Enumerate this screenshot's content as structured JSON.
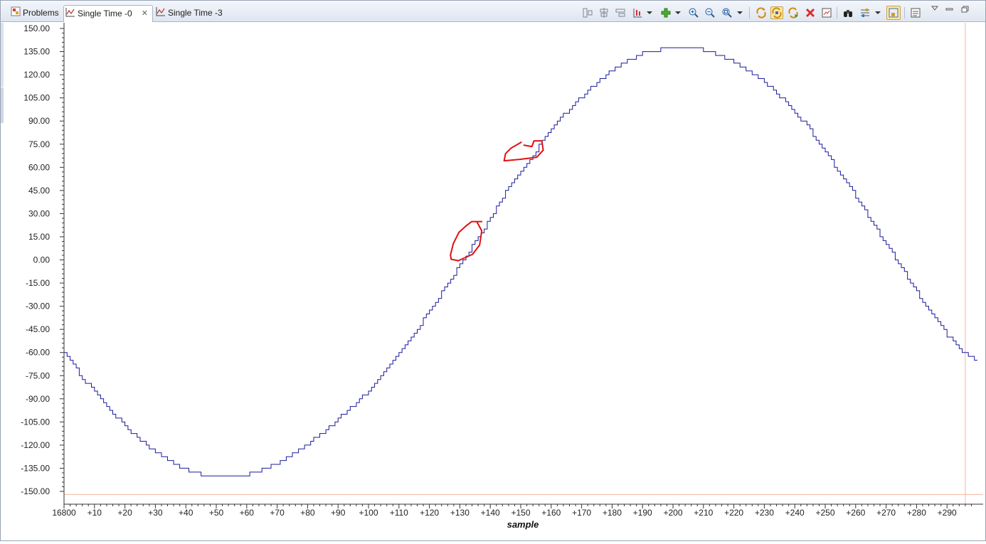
{
  "tabs": [
    {
      "label": "Problems"
    },
    {
      "label": "Single Time -0"
    },
    {
      "label": "Single Time -3"
    }
  ],
  "toolbar_icons": [
    "align-left-icon",
    "align-center-icon",
    "align-right-icon",
    "chart-cursor-icon",
    "add-graph-icon",
    "zoom-in-icon",
    "zoom-out-icon",
    "zoom-fit-icon",
    "refresh-icon",
    "auto-refresh-icon",
    "continuous-refresh-icon",
    "remove-icon",
    "export-icon",
    "find-icon",
    "properties-icon",
    "pin-icon",
    "legend-icon",
    "view-menu-icon",
    "minimize-icon",
    "maximize-icon"
  ],
  "colors": {
    "series": "#1a1a9c",
    "annotation": "#e01010",
    "limit_line": "#f2b6a0",
    "axis": "#333333"
  },
  "chart_data": {
    "type": "line",
    "xlabel": "sample",
    "ylabel": "",
    "x_start_label": "16800",
    "xlim": [
      0,
      300
    ],
    "ylim": [
      -150,
      150
    ],
    "yticks": [
      "150.00",
      "135.00",
      "120.00",
      "105.00",
      "90.00",
      "75.00",
      "60.00",
      "45.00",
      "30.00",
      "15.00",
      "0.00",
      "-15.00",
      "-30.00",
      "-45.00",
      "-60.00",
      "-75.00",
      "-90.00",
      "-105.00",
      "-120.00",
      "-135.00",
      "-150.00"
    ],
    "xticks": [
      "16800",
      "+10",
      "+20",
      "+30",
      "+40",
      "+50",
      "+60",
      "+70",
      "+80",
      "+90",
      "+100",
      "+110",
      "+120",
      "+130",
      "+140",
      "+150",
      "+160",
      "+170",
      "+180",
      "+190",
      "+200",
      "+210",
      "+220",
      "+230",
      "+240",
      "+250",
      "+260",
      "+270",
      "+280",
      "+290"
    ],
    "series": [
      {
        "staircase": true,
        "points": [
          [
            0,
            -60
          ],
          [
            5,
            -74
          ],
          [
            10,
            -86
          ],
          [
            15,
            -97
          ],
          [
            20,
            -108
          ],
          [
            25,
            -117
          ],
          [
            30,
            -125
          ],
          [
            35,
            -131
          ],
          [
            40,
            -136
          ],
          [
            45,
            -139
          ],
          [
            50,
            -141
          ],
          [
            55,
            -141
          ],
          [
            60,
            -139
          ],
          [
            65,
            -136
          ],
          [
            70,
            -132
          ],
          [
            75,
            -126
          ],
          [
            80,
            -119
          ],
          [
            85,
            -112
          ],
          [
            90,
            -103
          ],
          [
            95,
            -94
          ],
          [
            100,
            -85
          ],
          [
            105,
            -73
          ],
          [
            110,
            -60
          ],
          [
            115,
            -47
          ],
          [
            120,
            -33
          ],
          [
            125,
            -18
          ],
          [
            130,
            -3
          ],
          [
            135,
            12
          ],
          [
            140,
            27
          ],
          [
            145,
            44
          ],
          [
            150,
            58
          ],
          [
            155,
            71
          ],
          [
            160,
            85
          ],
          [
            165,
            96
          ],
          [
            170,
            106
          ],
          [
            175,
            115
          ],
          [
            180,
            123
          ],
          [
            185,
            129
          ],
          [
            190,
            134
          ],
          [
            195,
            136
          ],
          [
            200,
            138
          ],
          [
            205,
            138
          ],
          [
            210,
            136
          ],
          [
            215,
            133
          ],
          [
            220,
            128
          ],
          [
            225,
            122
          ],
          [
            230,
            115
          ],
          [
            235,
            106
          ],
          [
            240,
            96
          ],
          [
            245,
            84
          ],
          [
            250,
            70
          ],
          [
            255,
            55
          ],
          [
            260,
            41
          ],
          [
            265,
            25
          ],
          [
            270,
            10
          ],
          [
            275,
            -5
          ],
          [
            280,
            -21
          ],
          [
            285,
            -35
          ],
          [
            290,
            -49
          ],
          [
            295,
            -60
          ],
          [
            300,
            -66
          ]
        ]
      }
    ],
    "limit_lines": {
      "y": -152,
      "x": 296
    },
    "annotations": [
      {
        "type": "freehand-circle",
        "x_center": 133,
        "y_center": 5
      },
      {
        "type": "freehand-circle",
        "x_center": 152,
        "y_center": 67
      }
    ]
  }
}
